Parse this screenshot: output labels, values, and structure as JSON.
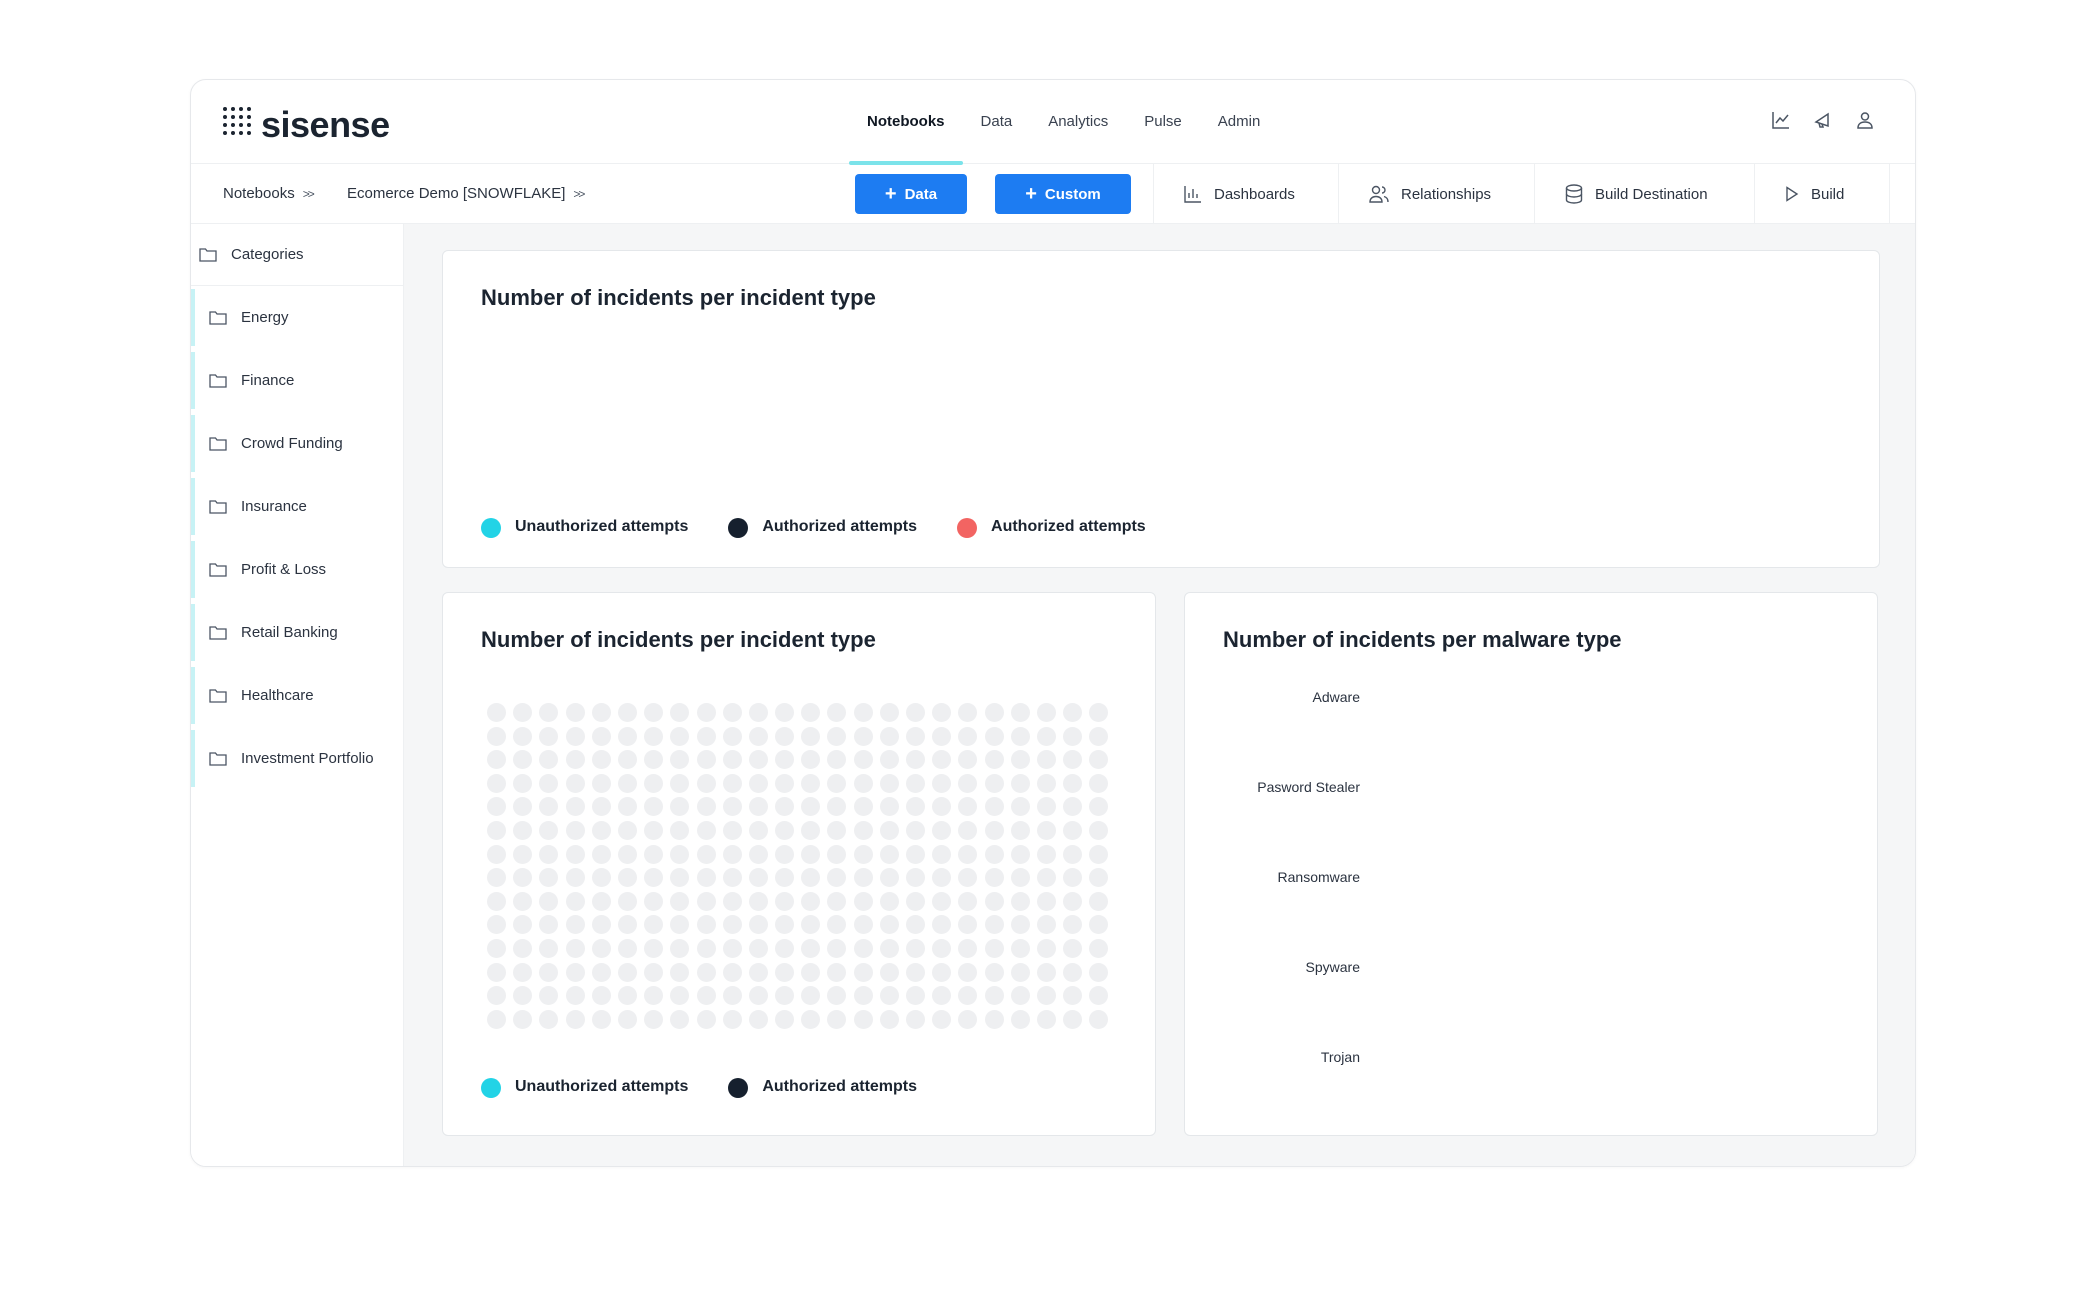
{
  "brand": {
    "name": "sisense"
  },
  "nav": {
    "items": [
      {
        "label": "Notebooks",
        "active": true
      },
      {
        "label": "Data"
      },
      {
        "label": "Analytics"
      },
      {
        "label": "Pulse"
      },
      {
        "label": "Admin"
      }
    ]
  },
  "top_icons": [
    "chart-line-icon",
    "megaphone-icon",
    "user-icon"
  ],
  "breadcrumb": {
    "items": [
      {
        "label": "Notebooks",
        "sep": ">>"
      },
      {
        "label": "Ecomerce Demo [SNOWFLAKE]",
        "sep": ">>"
      }
    ]
  },
  "toolbar": {
    "data_button": "Data",
    "custom_button": "Custom",
    "tabs": [
      {
        "label": "Dashboards",
        "icon": "bar-chart-icon"
      },
      {
        "label": "Relationships",
        "icon": "users-icon"
      },
      {
        "label": "Build Destination",
        "icon": "database-icon"
      },
      {
        "label": "Build",
        "icon": "play-icon"
      }
    ]
  },
  "sidebar": {
    "header": "Categories",
    "items": [
      {
        "label": "Energy"
      },
      {
        "label": "Finance"
      },
      {
        "label": "Crowd Funding"
      },
      {
        "label": "Insurance"
      },
      {
        "label": "Profit & Loss"
      },
      {
        "label": "Retail Banking"
      },
      {
        "label": "Healthcare"
      },
      {
        "label": "Investment Portfolio"
      }
    ]
  },
  "colors": {
    "accent": "#1d7cf2",
    "cyan": "#22d3e6",
    "navy": "#16202e",
    "red": "#f26462",
    "placeholder_dot": "#eeeff1"
  },
  "cards": {
    "top": {
      "title": "Number of incidents per incident type",
      "legend": [
        "Unauthorized attempts",
        "Authorized attempts",
        "Authorized attempts"
      ]
    },
    "bottom_left": {
      "title": "Number of incidents per incident type",
      "legend": [
        "Unauthorized attempts",
        "Authorized attempts"
      ]
    },
    "bottom_right": {
      "title": "Number of incidents per malware type",
      "categories": [
        "Adware",
        "Pasword Stealer",
        "Ransomware",
        "Spyware",
        "Trojan"
      ]
    }
  },
  "chart_data": [
    {
      "type": "bar",
      "title": "Number of incidents per incident type",
      "series": [
        {
          "name": "Unauthorized attempts",
          "values": []
        },
        {
          "name": "Authorized attempts",
          "values": []
        },
        {
          "name": "Authorized attempts",
          "values": []
        }
      ]
    },
    {
      "type": "scatter",
      "title": "Number of incidents per incident type",
      "series": [
        {
          "name": "Unauthorized attempts",
          "values": []
        },
        {
          "name": "Authorized attempts",
          "values": []
        }
      ]
    },
    {
      "type": "bar",
      "title": "Number of incidents per malware type",
      "categories": [
        "Adware",
        "Pasword Stealer",
        "Ransomware",
        "Spyware",
        "Trojan"
      ],
      "values": []
    }
  ]
}
